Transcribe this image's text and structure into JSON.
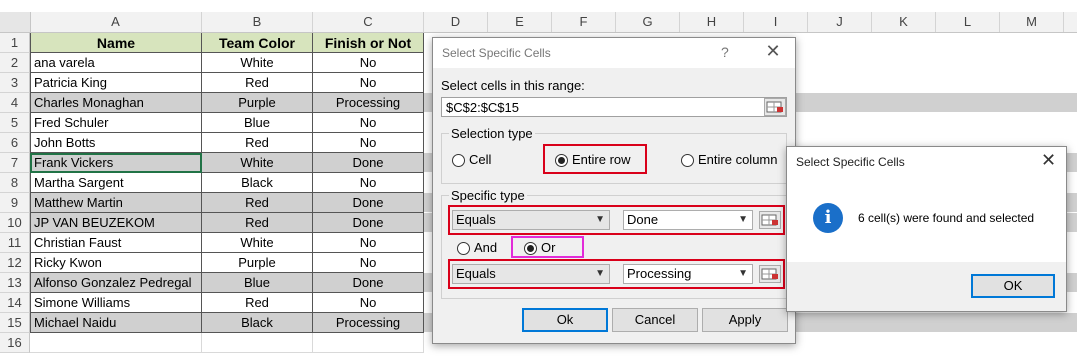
{
  "columns": [
    "A",
    "B",
    "C",
    "D",
    "E",
    "F",
    "G",
    "H",
    "I",
    "J",
    "K",
    "L",
    "M"
  ],
  "header_row": {
    "name": "Name",
    "team": "Team Color",
    "finish": "Finish or Not"
  },
  "rows": [
    {
      "num": "2",
      "name": "ana varela",
      "team": "White",
      "finish": "No",
      "selected": false
    },
    {
      "num": "3",
      "name": "Patricia King",
      "team": "Red",
      "finish": "No",
      "selected": false
    },
    {
      "num": "4",
      "name": "Charles Monaghan",
      "team": "Purple",
      "finish": "Processing",
      "selected": true
    },
    {
      "num": "5",
      "name": "Fred Schuler",
      "team": "Blue",
      "finish": "No",
      "selected": false
    },
    {
      "num": "6",
      "name": "John Botts",
      "team": "Red",
      "finish": "No",
      "selected": false
    },
    {
      "num": "7",
      "name": "Frank Vickers",
      "team": "White",
      "finish": "Done",
      "selected": true
    },
    {
      "num": "8",
      "name": "Martha Sargent",
      "team": "Black",
      "finish": "No",
      "selected": false
    },
    {
      "num": "9",
      "name": "Matthew Martin",
      "team": "Red",
      "finish": "Done",
      "selected": true
    },
    {
      "num": "10",
      "name": "JP VAN BEUZEKOM",
      "team": "Red",
      "finish": "Done",
      "selected": true
    },
    {
      "num": "11",
      "name": "Christian Faust",
      "team": "White",
      "finish": "No",
      "selected": false
    },
    {
      "num": "12",
      "name": "Ricky Kwon",
      "team": "Purple",
      "finish": "No",
      "selected": false
    },
    {
      "num": "13",
      "name": "Alfonso Gonzalez Pedregal",
      "team": "Blue",
      "finish": "Done",
      "selected": true
    },
    {
      "num": "14",
      "name": "Simone Williams",
      "team": "Red",
      "finish": "No",
      "selected": false
    },
    {
      "num": "15",
      "name": "Michael Naidu",
      "team": "Black",
      "finish": "Processing",
      "selected": true
    },
    {
      "num": "16",
      "name": "",
      "team": "",
      "finish": "",
      "selected": false
    }
  ],
  "dialog": {
    "title": "Select Specific Cells",
    "help": "?",
    "close": "✕",
    "range_label": "Select cells in this range:",
    "range_value": "$C$2:$C$15",
    "selection_type_label": "Selection type",
    "opt_cell": "Cell",
    "opt_entire_row": "Entire row",
    "opt_entire_column": "Entire column",
    "specific_type_label": "Specific type",
    "cond1_op": "Equals",
    "cond1_val": "Done",
    "and_label": "And",
    "or_label": "Or",
    "cond2_op": "Equals",
    "cond2_val": "Processing",
    "ok": "Ok",
    "cancel": "Cancel",
    "apply": "Apply"
  },
  "message": {
    "title": "Select Specific Cells",
    "close": "✕",
    "text": "6 cell(s) were found and selected",
    "icon": "info-icon",
    "ok": "OK"
  },
  "colors": {
    "header_fill": "#d7e4bd",
    "selected_fill": "#d0d0d0",
    "highlight_red": "#d9001a",
    "highlight_pink": "#e22bd8",
    "accent": "#0078d7"
  }
}
